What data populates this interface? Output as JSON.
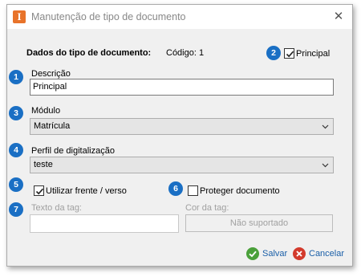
{
  "window": {
    "title": "Manutenção de tipo de documento",
    "app_icon_letter": "I"
  },
  "header": {
    "section_title": "Dados do tipo de documento:",
    "code_text": "Código: 1"
  },
  "badges": [
    "1",
    "2",
    "3",
    "4",
    "5",
    "6",
    "7"
  ],
  "principal": {
    "label": "Principal",
    "checked": true
  },
  "descricao": {
    "label": "Descrição",
    "value": "Principal"
  },
  "modulo": {
    "label": "Módulo",
    "value": "Matrícula"
  },
  "perfil": {
    "label": "Perfil de digitalização",
    "value": "teste"
  },
  "frente_verso": {
    "label": "Utilizar frente / verso",
    "checked": true
  },
  "proteger": {
    "label": "Proteger documento",
    "checked": false
  },
  "tag_text": {
    "label": "Texto da tag:",
    "value": ""
  },
  "tag_color": {
    "label": "Cor da tag:",
    "button": "Não suportado"
  },
  "footer": {
    "save_label": "Salvar",
    "cancel_label": "Cancelar"
  },
  "colors": {
    "badge": "#1a6fc4",
    "app_icon": "#e8732a",
    "save_icon": "#4aa03a",
    "cancel_icon": "#d33a2c",
    "link_text": "#1a5fa8"
  },
  "icons": [
    "app-icon",
    "close-icon",
    "chevron-down-icon",
    "checkmark-icon",
    "save-icon",
    "cancel-icon"
  ]
}
